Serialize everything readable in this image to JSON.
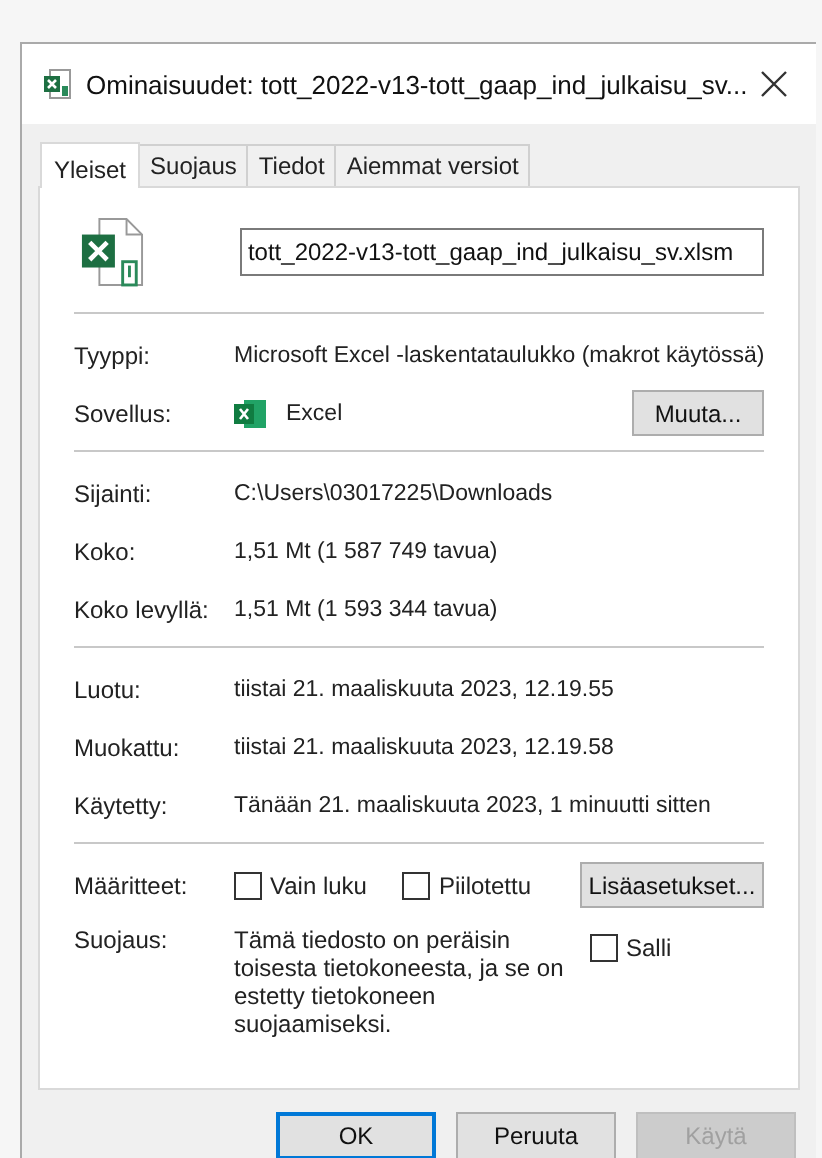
{
  "window": {
    "title": "Ominaisuudet: tott_2022-v13-tott_gaap_ind_julkaisu_sv..."
  },
  "tabs": [
    {
      "label": "Yleiset",
      "selected": true
    },
    {
      "label": "Suojaus",
      "selected": false
    },
    {
      "label": "Tiedot",
      "selected": false
    },
    {
      "label": "Aiemmat versiot",
      "selected": false
    }
  ],
  "file_name": "tott_2022-v13-tott_gaap_ind_julkaisu_sv.xlsm",
  "sections": [
    [
      {
        "kind": "text",
        "label": "Tyyppi:",
        "value": "Microsoft Excel -laskentataulukko (makrot käytössä)"
      },
      {
        "kind": "app",
        "label": "Sovellus:",
        "value": "Excel",
        "button": "Muuta..."
      }
    ],
    [
      {
        "kind": "text",
        "label": "Sijainti:",
        "value": "C:\\Users\\03017225\\Downloads"
      },
      {
        "kind": "text",
        "label": "Koko:",
        "value": "1,51 Mt (1 587 749 tavua)"
      },
      {
        "kind": "text",
        "label": "Koko levyllä:",
        "value": "1,51 Mt (1 593 344 tavua)"
      }
    ],
    [
      {
        "kind": "text",
        "label": "Luotu:",
        "value": "tiistai 21. maaliskuuta 2023, 12.19.55"
      },
      {
        "kind": "text",
        "label": "Muokattu:",
        "value": "tiistai 21. maaliskuuta 2023, 12.19.58"
      },
      {
        "kind": "text",
        "label": "Käytetty:",
        "value": "Tänään 21. maaliskuuta 2023, 1 minuutti sitten"
      }
    ]
  ],
  "attributes": {
    "label": "Määritteet:",
    "checkboxes": [
      {
        "label": "Vain luku",
        "checked": false
      },
      {
        "label": "Piilotettu",
        "checked": false
      }
    ],
    "button": "Lisäasetukset..."
  },
  "security": {
    "label": "Suojaus:",
    "text": "Tämä tiedosto on peräisin toisesta tietokoneesta, ja se on estetty tietokoneen suojaamiseksi.",
    "checkbox": {
      "label": "Salli",
      "checked": false
    }
  },
  "buttons": [
    {
      "label": "OK",
      "default": true,
      "disabled": false
    },
    {
      "label": "Peruuta",
      "default": false,
      "disabled": false
    },
    {
      "label": "Käytä",
      "default": false,
      "disabled": true
    }
  ]
}
